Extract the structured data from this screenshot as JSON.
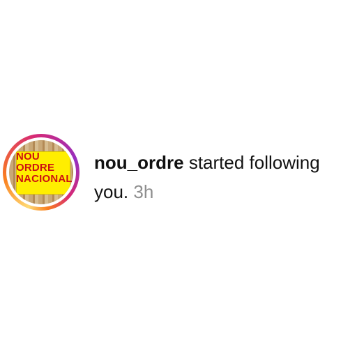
{
  "notification": {
    "avatar": {
      "icon": "profile-photo-icon",
      "sign_lines": [
        "NOU",
        "ORDRE",
        "NACIONAL"
      ]
    },
    "username": "nou_ordre",
    "action_text": "started following you.",
    "time": "3h"
  },
  "colors": {
    "text": "#111111",
    "timestamp": "#8e8e8e",
    "ring_gradient": [
      "#feda75",
      "#fa7e1e",
      "#d62976",
      "#962fbf"
    ],
    "sign_background": "#ffee00",
    "sign_text": "#cc1111"
  }
}
